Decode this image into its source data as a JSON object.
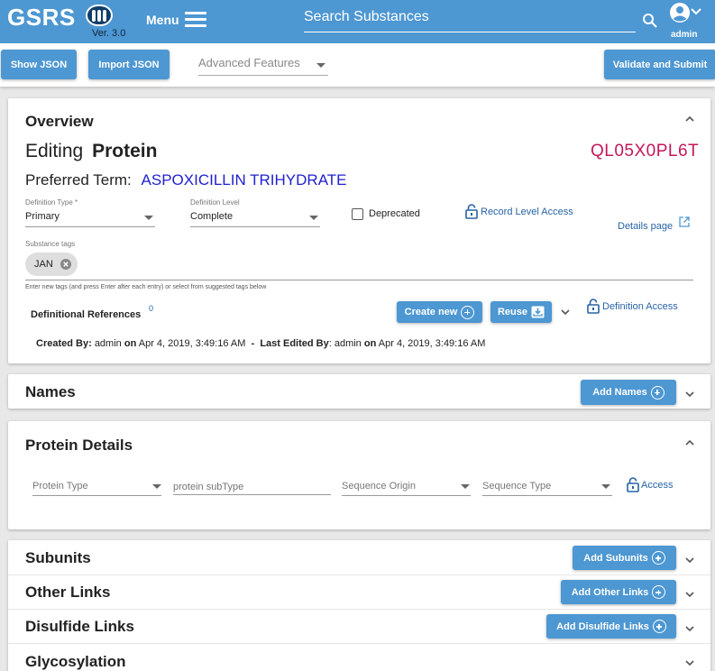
{
  "header": {
    "logo_text": "GSRS",
    "version": "Ver. 3.0",
    "menu_label": "Menu",
    "search_placeholder": "Search Substances",
    "user": "admin"
  },
  "toolbar": {
    "show_json": "Show JSON",
    "import_json": "Import JSON",
    "advanced_features": "Advanced Features",
    "validate_submit": "Validate and Submit"
  },
  "overview": {
    "title": "Overview",
    "editing_prefix": "Editing",
    "editing_type": "Protein",
    "code": "QL05X0PL6T",
    "preferred_label": "Preferred Term:",
    "preferred_value": "ASPOXICILLIN TRIHYDRATE",
    "definition_type_label": "Definition Type *",
    "definition_type_value": "Primary",
    "definition_level_label": "Definition Level",
    "definition_level_value": "Complete",
    "deprecated_label": "Deprecated",
    "record_access": "Record Level Access",
    "details_page": "Details page",
    "tags_label": "Substance tags",
    "tags": [
      "JAN"
    ],
    "tags_hint": "Enter new tags (and press Enter after each entry) or select from suggested tags below",
    "def_refs_label": "Definitional References",
    "def_refs_count": "0",
    "create_new": "Create new",
    "reuse": "Reuse",
    "definition_access": "Definition Access",
    "created_by_label": "Created By:",
    "created_by": "admin",
    "on1": "on",
    "created_date": "Apr 4, 2019, 3:49:16 AM",
    "dash": "-",
    "edited_by_label": "Last Edited By",
    "edited_colon": ":",
    "edited_by": "admin",
    "on2": "on",
    "edited_date": "Apr 4, 2019, 3:49:16 AM"
  },
  "names": {
    "title": "Names",
    "add": "Add Names"
  },
  "protein_details": {
    "title": "Protein Details",
    "protein_type": "Protein Type",
    "protein_subtype": "protein subType",
    "sequence_origin": "Sequence Origin",
    "sequence_type": "Sequence Type",
    "access": "Access"
  },
  "subunits": {
    "title": "Subunits",
    "add": "Add Subunits"
  },
  "other_links": {
    "title": "Other Links",
    "add": "Add Other Links"
  },
  "disulfide_links": {
    "title": "Disulfide Links",
    "add": "Add Disulfide Links"
  },
  "glycosylation": {
    "title": "Glycosylation"
  },
  "colors": {
    "primary": "#4d97d2",
    "code": "#c2185b",
    "link": "#2763a6",
    "term": "#1f1fcf"
  }
}
